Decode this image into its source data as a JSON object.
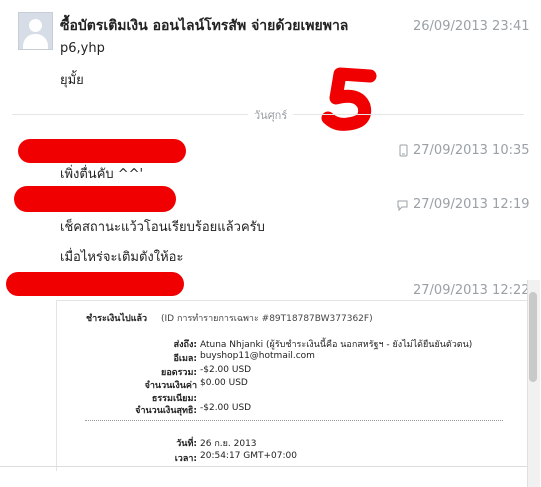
{
  "messages": [
    {
      "sender": "ซื้อบัตรเติมเงิน ออนไลน์โทรสัพ จ่ายด้วยเพยพาล",
      "timestamp": "26/09/2013 23:41",
      "lines": [
        "p6,yhp",
        "ยุมั้ย"
      ]
    },
    {
      "timestamp": "27/09/2013 10:35",
      "lines": [
        "เพิ่งตื่นคับ ^^'"
      ],
      "icon": "mobile-icon"
    },
    {
      "timestamp": "27/09/2013 12:19",
      "lines": [
        "เช็คสถานะแว้วโอนเรียบร้อยแล้วครับ",
        "เมื่อไหร่จะเติมตังให้อะ"
      ],
      "icon": "chat-bubble-icon"
    },
    {
      "timestamp": "27/09/2013 12:22"
    }
  ],
  "day_divider": "วันศุกร์",
  "receipt": {
    "title": "ชำระเงินไปแล้ว",
    "id_text": "(ID การทำรายการเฉพาะ #89T18787BW377362F)",
    "rows": [
      {
        "label": "ส่งถึง:",
        "value": "Atuna Nhjanki (ผู้รับชำระเงินนี้คือ นอกสหรัฐฯ - ยังไม่ได้ยืนยันตัวตน)"
      },
      {
        "label": "อีเมล:",
        "value": "buyshop11@hotmail.com"
      },
      {
        "label": "ยอดรวม:",
        "value": "-$2.00 USD"
      },
      {
        "label": "จำนวนเงินค่า",
        "value": "$0.00 USD"
      },
      {
        "label": "ธรรมเนียม:",
        "value": ""
      },
      {
        "label": "จำนวนเงินสุทธิ:",
        "value": "-$2.00 USD"
      }
    ],
    "date_label": "วันที่:",
    "date_value": "26 ก.ย. 2013",
    "time_label": "เวลา:",
    "time_value": "20:54:17 GMT+07:00"
  },
  "annotation": "5",
  "colors": {
    "redact": "#f00000",
    "timestamp": "#9aa0a6"
  }
}
